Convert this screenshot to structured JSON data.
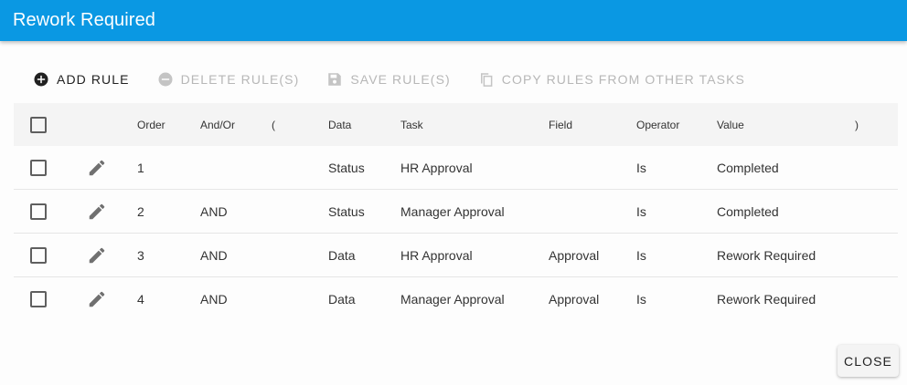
{
  "dialog": {
    "title": "Rework Required"
  },
  "toolbar": {
    "add_rule": "ADD RULE",
    "delete_rules": "DELETE RULE(S)",
    "save_rules": "SAVE RULE(S)",
    "copy_rules": "COPY RULES FROM OTHER TASKS"
  },
  "table": {
    "headers": {
      "order": "Order",
      "andor": "And/Or",
      "open_paren": "(",
      "data": "Data",
      "task": "Task",
      "field": "Field",
      "operator": "Operator",
      "value": "Value",
      "close_paren": ")"
    },
    "rows": [
      {
        "order": "1",
        "andor": "",
        "data": "Status",
        "task": "HR Approval",
        "field": "",
        "operator": "Is",
        "value": "Completed"
      },
      {
        "order": "2",
        "andor": "AND",
        "data": "Status",
        "task": "Manager Approval",
        "field": "",
        "operator": "Is",
        "value": "Completed"
      },
      {
        "order": "3",
        "andor": "AND",
        "data": "Data",
        "task": "HR Approval",
        "field": "Approval",
        "operator": "Is",
        "value": "Rework Required"
      },
      {
        "order": "4",
        "andor": "AND",
        "data": "Data",
        "task": "Manager Approval",
        "field": "Approval",
        "operator": "Is",
        "value": "Rework Required"
      }
    ]
  },
  "footer": {
    "close_label": "CLOSE"
  },
  "icons": {
    "add": "add-circle-icon",
    "delete": "remove-circle-icon",
    "save": "save-icon",
    "copy": "copy-icon",
    "edit": "pencil-icon"
  },
  "colors": {
    "titlebar": "#0a98e3",
    "disabled_text": "#b7b7b7",
    "header_row": "#f4f4f4"
  }
}
